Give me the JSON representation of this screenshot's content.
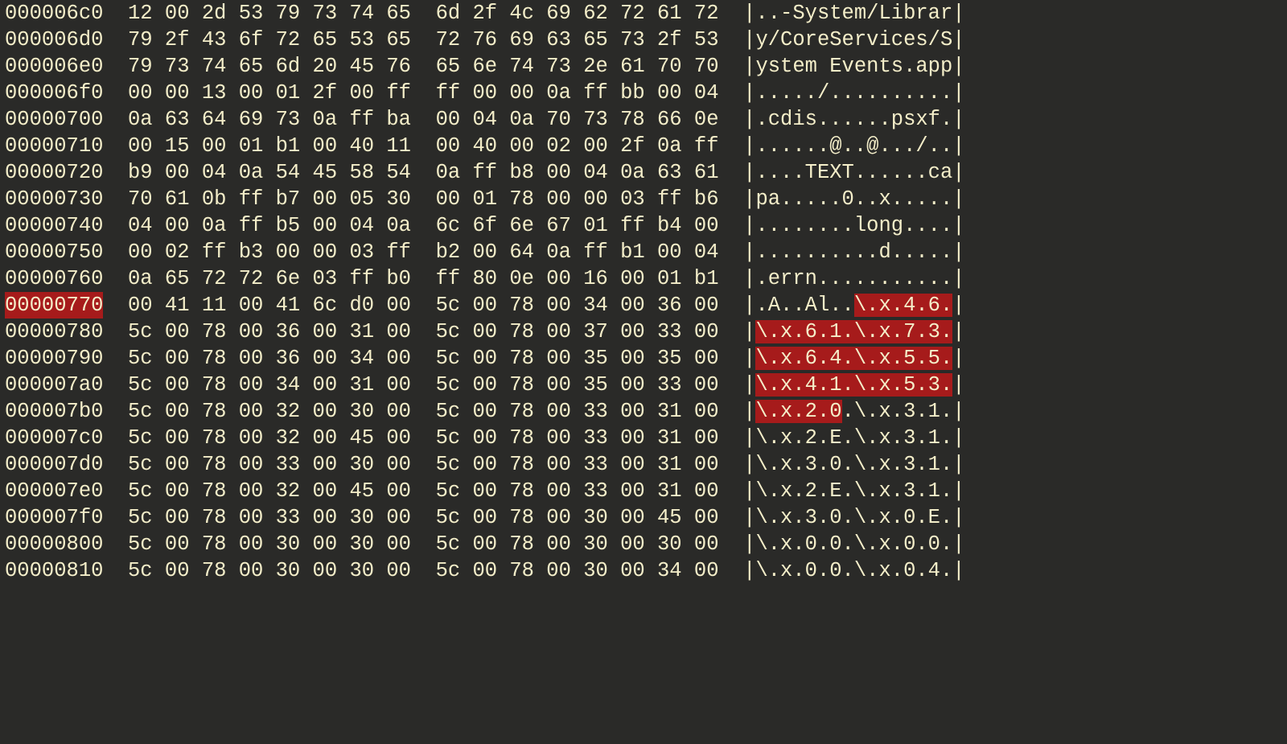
{
  "rows": [
    {
      "offset": "000006c0",
      "hex_left": "12 00 2d 53 79 73 74 65",
      "hex_right": "6d 2f 4c 69 62 72 61 72",
      "ascii": [
        {
          "t": "..-System/Librar"
        }
      ]
    },
    {
      "offset": "000006d0",
      "hex_left": "79 2f 43 6f 72 65 53 65",
      "hex_right": "72 76 69 63 65 73 2f 53",
      "ascii": [
        {
          "t": "y/CoreServices/S"
        }
      ]
    },
    {
      "offset": "000006e0",
      "hex_left": "79 73 74 65 6d 20 45 76",
      "hex_right": "65 6e 74 73 2e 61 70 70",
      "ascii": [
        {
          "t": "ystem Events.app"
        }
      ]
    },
    {
      "offset": "000006f0",
      "hex_left": "00 00 13 00 01 2f 00 ff",
      "hex_right": "ff 00 00 0a ff bb 00 04",
      "ascii": [
        {
          "t": "...../.........."
        }
      ]
    },
    {
      "offset": "00000700",
      "hex_left": "0a 63 64 69 73 0a ff ba",
      "hex_right": "00 04 0a 70 73 78 66 0e",
      "ascii": [
        {
          "t": ".cdis......psxf."
        }
      ]
    },
    {
      "offset": "00000710",
      "hex_left": "00 15 00 01 b1 00 40 11",
      "hex_right": "00 40 00 02 00 2f 0a ff",
      "ascii": [
        {
          "t": "......@..@.../.."
        }
      ]
    },
    {
      "offset": "00000720",
      "hex_left": "b9 00 04 0a 54 45 58 54",
      "hex_right": "0a ff b8 00 04 0a 63 61",
      "ascii": [
        {
          "t": "....TEXT......ca"
        }
      ]
    },
    {
      "offset": "00000730",
      "hex_left": "70 61 0b ff b7 00 05 30",
      "hex_right": "00 01 78 00 00 03 ff b6",
      "ascii": [
        {
          "t": "pa.....0..x....."
        }
      ]
    },
    {
      "offset": "00000740",
      "hex_left": "04 00 0a ff b5 00 04 0a",
      "hex_right": "6c 6f 6e 67 01 ff b4 00",
      "ascii": [
        {
          "t": "........long...."
        }
      ]
    },
    {
      "offset": "00000750",
      "hex_left": "00 02 ff b3 00 00 03 ff",
      "hex_right": "b2 00 64 0a ff b1 00 04",
      "ascii": [
        {
          "t": "..........d....."
        }
      ]
    },
    {
      "offset": "00000760",
      "hex_left": "0a 65 72 72 6e 03 ff b0",
      "hex_right": "ff 80 0e 00 16 00 01 b1",
      "ascii": [
        {
          "t": ".errn..........."
        }
      ]
    },
    {
      "offset": "00000770",
      "offset_hl": true,
      "hex_left": "00 41 11 00 41 6c d0 00",
      "hex_right": "5c 00 78 00 34 00 36 00",
      "ascii": [
        {
          "t": ".A..Al.."
        },
        {
          "t": "\\.x.4.6.",
          "hl": true
        }
      ]
    },
    {
      "offset": "00000780",
      "hex_left": "5c 00 78 00 36 00 31 00",
      "hex_right": "5c 00 78 00 37 00 33 00",
      "ascii": [
        {
          "t": "\\.x.6.1.\\.x.7.3.",
          "hl": true
        }
      ]
    },
    {
      "offset": "00000790",
      "hex_left": "5c 00 78 00 36 00 34 00",
      "hex_right": "5c 00 78 00 35 00 35 00",
      "ascii": [
        {
          "t": "\\.x.6.4.\\.x.5.5.",
          "hl": true
        }
      ]
    },
    {
      "offset": "000007a0",
      "hex_left": "5c 00 78 00 34 00 31 00",
      "hex_right": "5c 00 78 00 35 00 33 00",
      "ascii": [
        {
          "t": "\\.x.4.1.\\.x.5.3.",
          "hl": true
        }
      ]
    },
    {
      "offset": "000007b0",
      "hex_left": "5c 00 78 00 32 00 30 00",
      "hex_right": "5c 00 78 00 33 00 31 00",
      "ascii": [
        {
          "t": "\\.x.2.0",
          "hl": true
        },
        {
          "t": ".\\.x.3.1."
        }
      ]
    },
    {
      "offset": "000007c0",
      "hex_left": "5c 00 78 00 32 00 45 00",
      "hex_right": "5c 00 78 00 33 00 31 00",
      "ascii": [
        {
          "t": "\\.x.2.E.\\.x.3.1."
        }
      ]
    },
    {
      "offset": "000007d0",
      "hex_left": "5c 00 78 00 33 00 30 00",
      "hex_right": "5c 00 78 00 33 00 31 00",
      "ascii": [
        {
          "t": "\\.x.3.0.\\.x.3.1."
        }
      ]
    },
    {
      "offset": "000007e0",
      "hex_left": "5c 00 78 00 32 00 45 00",
      "hex_right": "5c 00 78 00 33 00 31 00",
      "ascii": [
        {
          "t": "\\.x.2.E.\\.x.3.1."
        }
      ]
    },
    {
      "offset": "000007f0",
      "hex_left": "5c 00 78 00 33 00 30 00",
      "hex_right": "5c 00 78 00 30 00 45 00",
      "ascii": [
        {
          "t": "\\.x.3.0.\\.x.0.E."
        }
      ]
    },
    {
      "offset": "00000800",
      "hex_left": "5c 00 78 00 30 00 30 00",
      "hex_right": "5c 00 78 00 30 00 30 00",
      "ascii": [
        {
          "t": "\\.x.0.0.\\.x.0.0."
        }
      ]
    },
    {
      "offset": "00000810",
      "hex_left": "5c 00 78 00 30 00 30 00",
      "hex_right": "5c 00 78 00 30 00 34 00",
      "ascii": [
        {
          "t": "\\.x.0.0.\\.x.0.4."
        }
      ]
    }
  ]
}
